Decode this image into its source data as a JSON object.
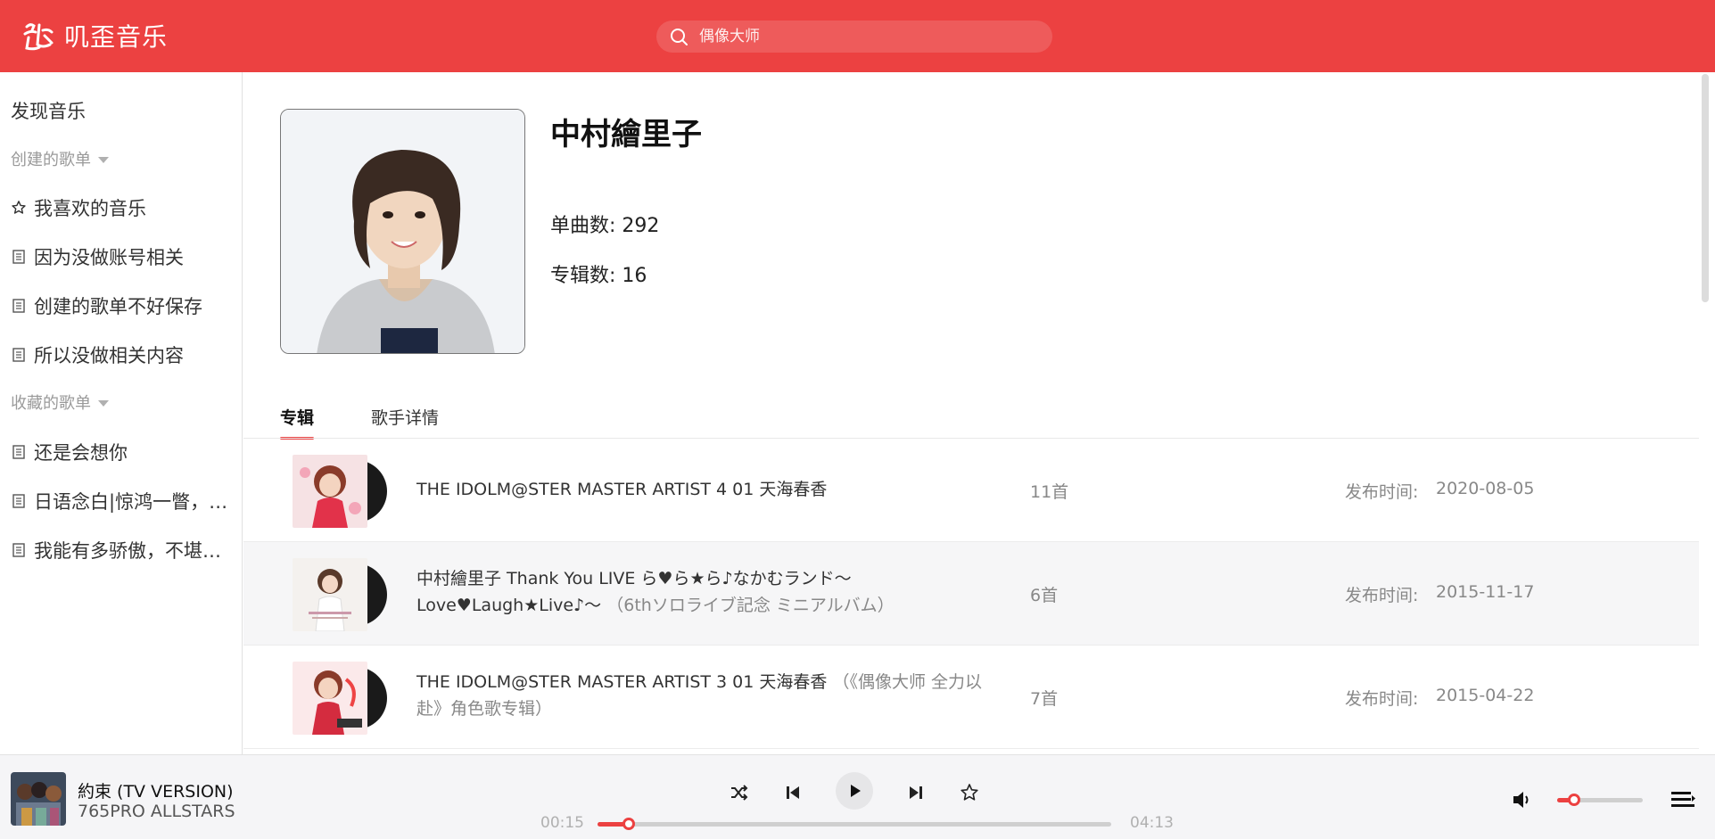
{
  "app": {
    "logo_text": "叽歪音乐",
    "brand_color": "#ec4141"
  },
  "search": {
    "placeholder": "偶像大师"
  },
  "sidebar": {
    "discover_label": "发现音乐",
    "created_section": "创建的歌单",
    "created_items": [
      {
        "label": "我喜欢的音乐",
        "icon": "star-icon"
      },
      {
        "label": "因为没做账号相关",
        "icon": "playlist-icon"
      },
      {
        "label": "创建的歌单不好保存",
        "icon": "playlist-icon"
      },
      {
        "label": "所以没做相关内容",
        "icon": "playlist-icon"
      }
    ],
    "collected_section": "收藏的歌单",
    "collected_items": [
      {
        "label": "还是会想你",
        "icon": "playlist-icon"
      },
      {
        "label": "日语念白|惊鸿一瞥，若梦一场",
        "icon": "playlist-icon"
      },
      {
        "label": "我能有多骄傲，不堪一击",
        "icon": "playlist-icon"
      }
    ]
  },
  "artist": {
    "name": "中村繪里子",
    "songs_label": "单曲数:",
    "songs_count": "292",
    "albums_label": "专辑数:",
    "albums_count": "16"
  },
  "tabs": [
    {
      "label": "专辑",
      "active": true
    },
    {
      "label": "歌手详情",
      "active": false
    }
  ],
  "albums": [
    {
      "title": "THE IDOLM@STER MASTER ARTIST 4 01 天海春香",
      "subtitle": "",
      "count": "11首",
      "date_label": "发布时间:",
      "date": "2020-08-05"
    },
    {
      "title": "中村繪里子 Thank You LIVE ら♥ら★ら♪なかむランド～Love♥Laugh★Live♪～",
      "subtitle": "（6thソロライブ記念 ミニアルバム）",
      "count": "6首",
      "date_label": "发布时间:",
      "date": "2015-11-17"
    },
    {
      "title": "THE IDOLM@STER MASTER ARTIST 3 01 天海春香",
      "subtitle": "（《偶像大师 全力以赴》角色歌专辑）",
      "count": "7首",
      "date_label": "发布时间:",
      "date": "2015-04-22"
    }
  ],
  "player": {
    "title": "約束 (TV VERSION)",
    "artist": "765PRO ALLSTARS",
    "current_time": "00:15",
    "total_time": "04:13",
    "progress": 0.06,
    "volume": 0.2
  }
}
